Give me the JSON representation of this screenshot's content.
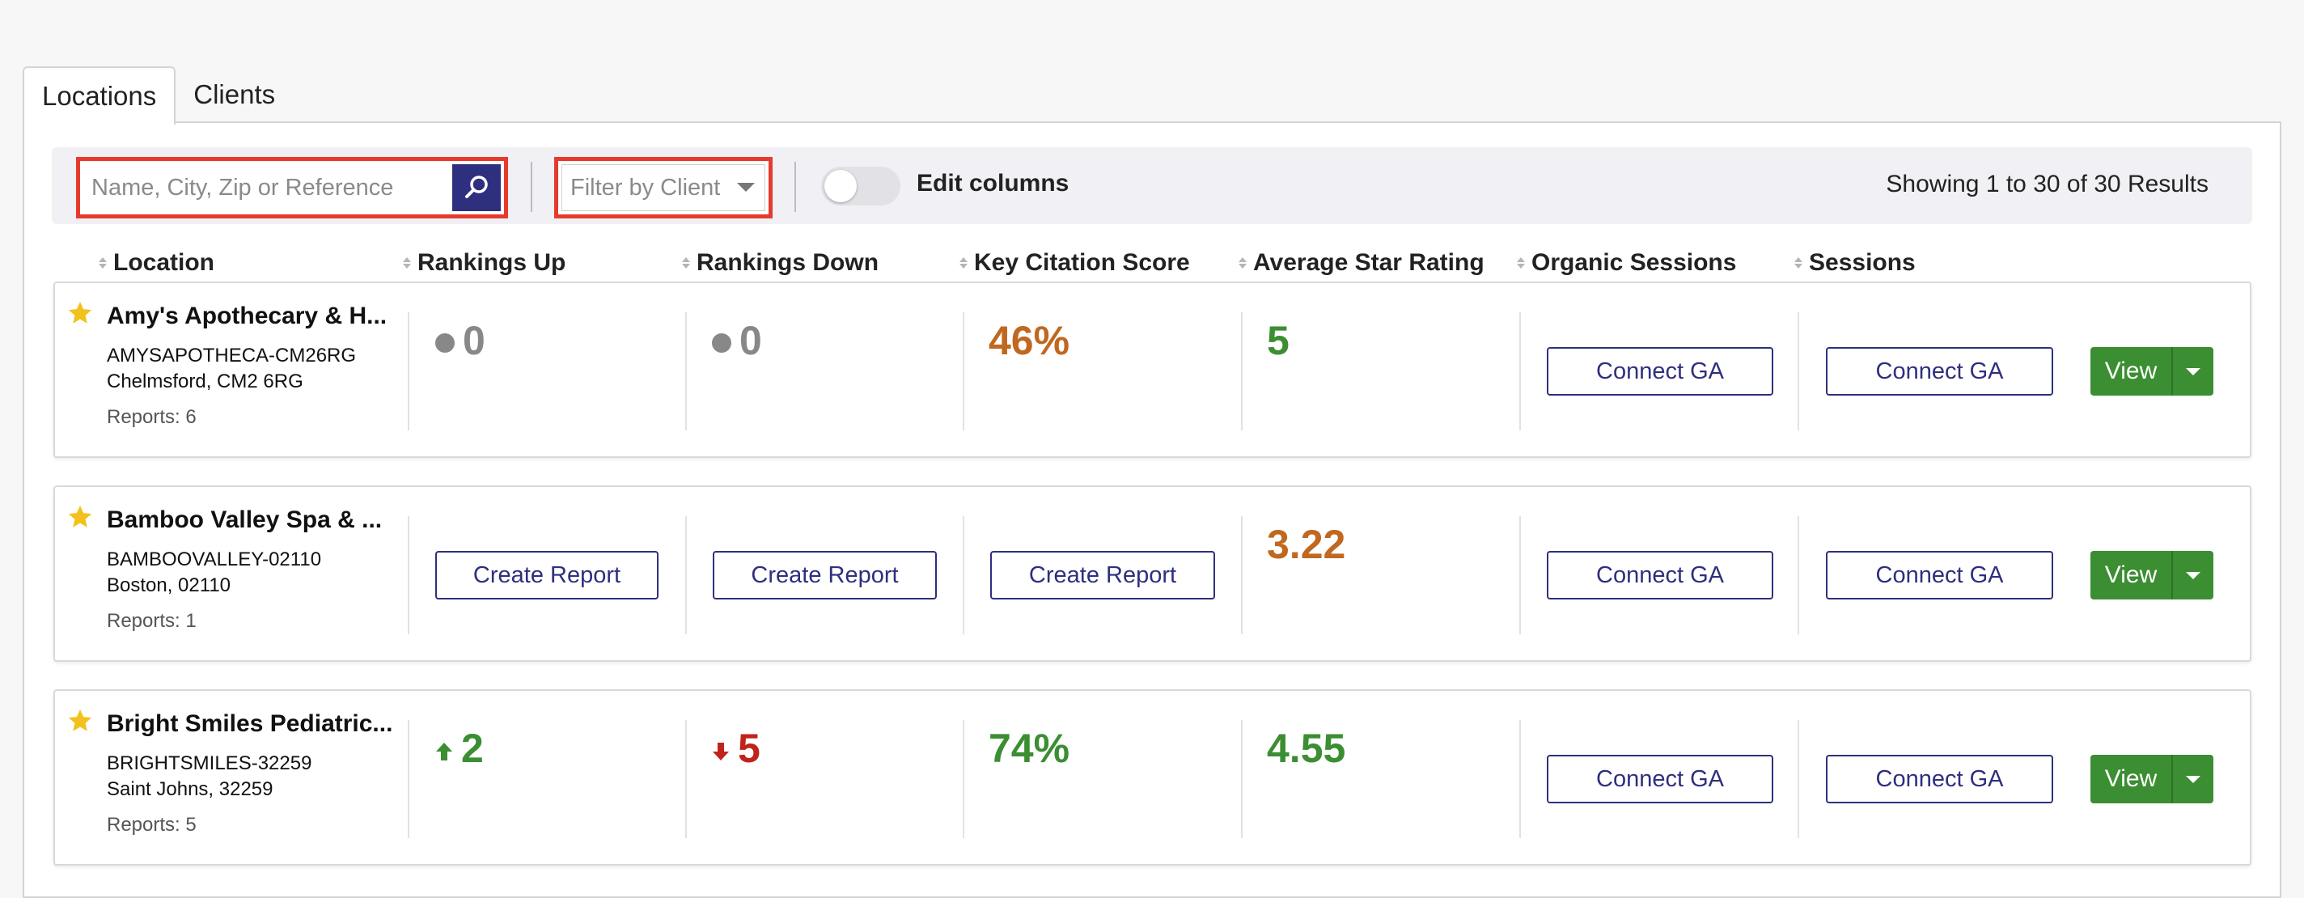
{
  "tabs": [
    {
      "label": "Locations"
    },
    {
      "label": "Clients"
    }
  ],
  "toolbar": {
    "search_placeholder": "Name, City, Zip or Reference",
    "filter_placeholder": "Filter by Client",
    "edit_columns_label": "Edit columns",
    "edit_columns_enabled": false,
    "showing_text": "Showing 1 to 30 of 30 Results"
  },
  "columns": [
    "Location",
    "Rankings Up",
    "Rankings Down",
    "Key Citation Score",
    "Average Star Rating",
    "Organic Sessions",
    "Sessions"
  ],
  "rows": [
    {
      "name": "Amy's Apothecary & H...",
      "reference": "AMYSAPOTHECA-CM26RG",
      "city": "Chelmsford, CM2 6RG",
      "reports": "Reports: 6",
      "rankings_up": "0",
      "rankings_down": "0",
      "key_citation": "46%",
      "avg_star": "5",
      "organic_sessions": "Connect GA",
      "sessions": "Connect GA",
      "view_label": "View"
    },
    {
      "name": "Bamboo Valley Spa & ...",
      "reference": "BAMBOOVALLEY-02110",
      "city": "Boston, 02110",
      "reports": "Reports: 1",
      "rankings_up": "Create Report",
      "rankings_down": "Create Report",
      "key_citation": "Create Report",
      "avg_star": "3.22",
      "organic_sessions": "Connect GA",
      "sessions": "Connect GA",
      "view_label": "View"
    },
    {
      "name": "Bright Smiles Pediatric...",
      "reference": "BRIGHTSMILES-32259",
      "city": "Saint Johns, 32259",
      "reports": "Reports: 5",
      "rankings_up": "2",
      "rankings_down": "5",
      "key_citation": "74%",
      "avg_star": "4.55",
      "organic_sessions": "Connect GA",
      "sessions": "Connect GA",
      "view_label": "View"
    }
  ],
  "colors": {
    "brand_navy": "#2e2f7e",
    "green": "#3b8e32",
    "orange": "#c0681f",
    "red": "#c0231b",
    "neutral": "#888888",
    "star": "#f2c21b",
    "highlight_border": "#e53b2c"
  },
  "icons": {
    "search": "search-icon",
    "favorite": "star-icon",
    "trend_up": "arrow-up-icon",
    "trend_down": "arrow-down-icon",
    "dropdown": "chevron-down-icon",
    "sort": "sort-icon"
  }
}
